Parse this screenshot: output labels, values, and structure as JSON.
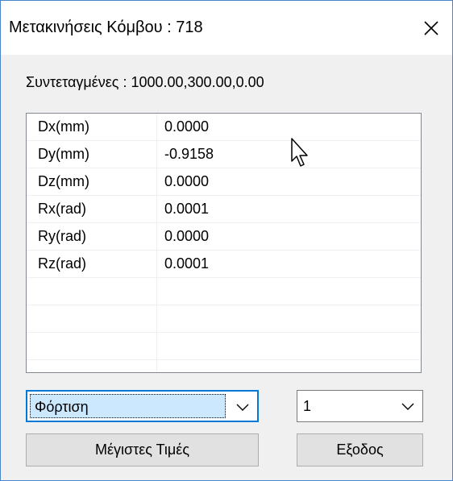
{
  "window": {
    "title": "Μετακινήσεις Κόμβου : 718"
  },
  "coordinates": "Συντεταγμένες : 1000.00,300.00,0.00",
  "table": {
    "rows": [
      {
        "name": "Dx(mm)",
        "value": "0.0000"
      },
      {
        "name": "Dy(mm)",
        "value": "-0.9158"
      },
      {
        "name": "Dz(mm)",
        "value": "0.0000"
      },
      {
        "name": "Rx(rad)",
        "value": "0.0001"
      },
      {
        "name": "Ry(rad)",
        "value": "0.0000"
      },
      {
        "name": "Rz(rad)",
        "value": "0.0001"
      },
      {
        "name": "",
        "value": ""
      },
      {
        "name": "",
        "value": ""
      },
      {
        "name": "",
        "value": ""
      },
      {
        "name": "",
        "value": ""
      }
    ]
  },
  "controls": {
    "load_select": "Φόρτιση",
    "case_select": "1",
    "max_button": "Μέγιστες Τιμές",
    "exit_button": "Εξοδος"
  },
  "icons": {
    "close": "close-icon",
    "chevron": "chevron-down-icon",
    "cursor": "mouse-pointer-icon"
  },
  "colors": {
    "accent": "#0078d7",
    "selection": "#cce8ff",
    "window_border": "#4a84c9"
  }
}
